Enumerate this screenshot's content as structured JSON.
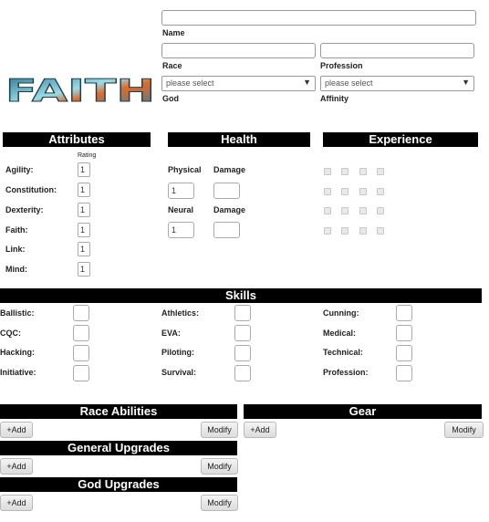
{
  "header": {
    "logo_text": "FAITH",
    "name_label": "Name",
    "name_value": "",
    "race_label": "Race",
    "race_value": "",
    "profession_label": "Profession",
    "profession_value": "",
    "god_label": "God",
    "god_select": "please select",
    "affinity_label": "Affinity",
    "affinity_select": "please select"
  },
  "attributes": {
    "title": "Attributes",
    "rating_label": "Rating",
    "items": [
      {
        "label": "Agility:",
        "value": "1"
      },
      {
        "label": "Constitution:",
        "value": "1"
      },
      {
        "label": "Dexterity:",
        "value": "1"
      },
      {
        "label": "Faith:",
        "value": "1"
      },
      {
        "label": "Link:",
        "value": "1"
      },
      {
        "label": "Mind:",
        "value": "1"
      }
    ]
  },
  "health": {
    "title": "Health",
    "physical_label": "Physical",
    "physical_value": "1",
    "physical_damage_label": "Damage",
    "neural_label": "Neural",
    "neural_value": "1",
    "neural_damage_label": "Damage"
  },
  "experience": {
    "title": "Experience"
  },
  "skills": {
    "title": "Skills",
    "col1": [
      "Ballistic:",
      "CQC:",
      "Hacking:",
      "Initiative:"
    ],
    "col2": [
      "Athletics:",
      "EVA:",
      "Piloting:",
      "Survival:"
    ],
    "col3": [
      "Cunning:",
      "Medical:",
      "Technical:",
      "Profession:"
    ]
  },
  "race_abilities": {
    "title": "Race Abilities",
    "add_label": "+Add",
    "modify_label": "Modify"
  },
  "gear": {
    "title": "Gear",
    "add_label": "+Add",
    "modify_label": "Modify"
  },
  "general_upgrades": {
    "title": "General Upgrades",
    "add_label": "+Add",
    "modify_label": "Modify"
  },
  "god_upgrades": {
    "title": "God Upgrades",
    "add_label": "+Add",
    "modify_label": "Modify"
  }
}
